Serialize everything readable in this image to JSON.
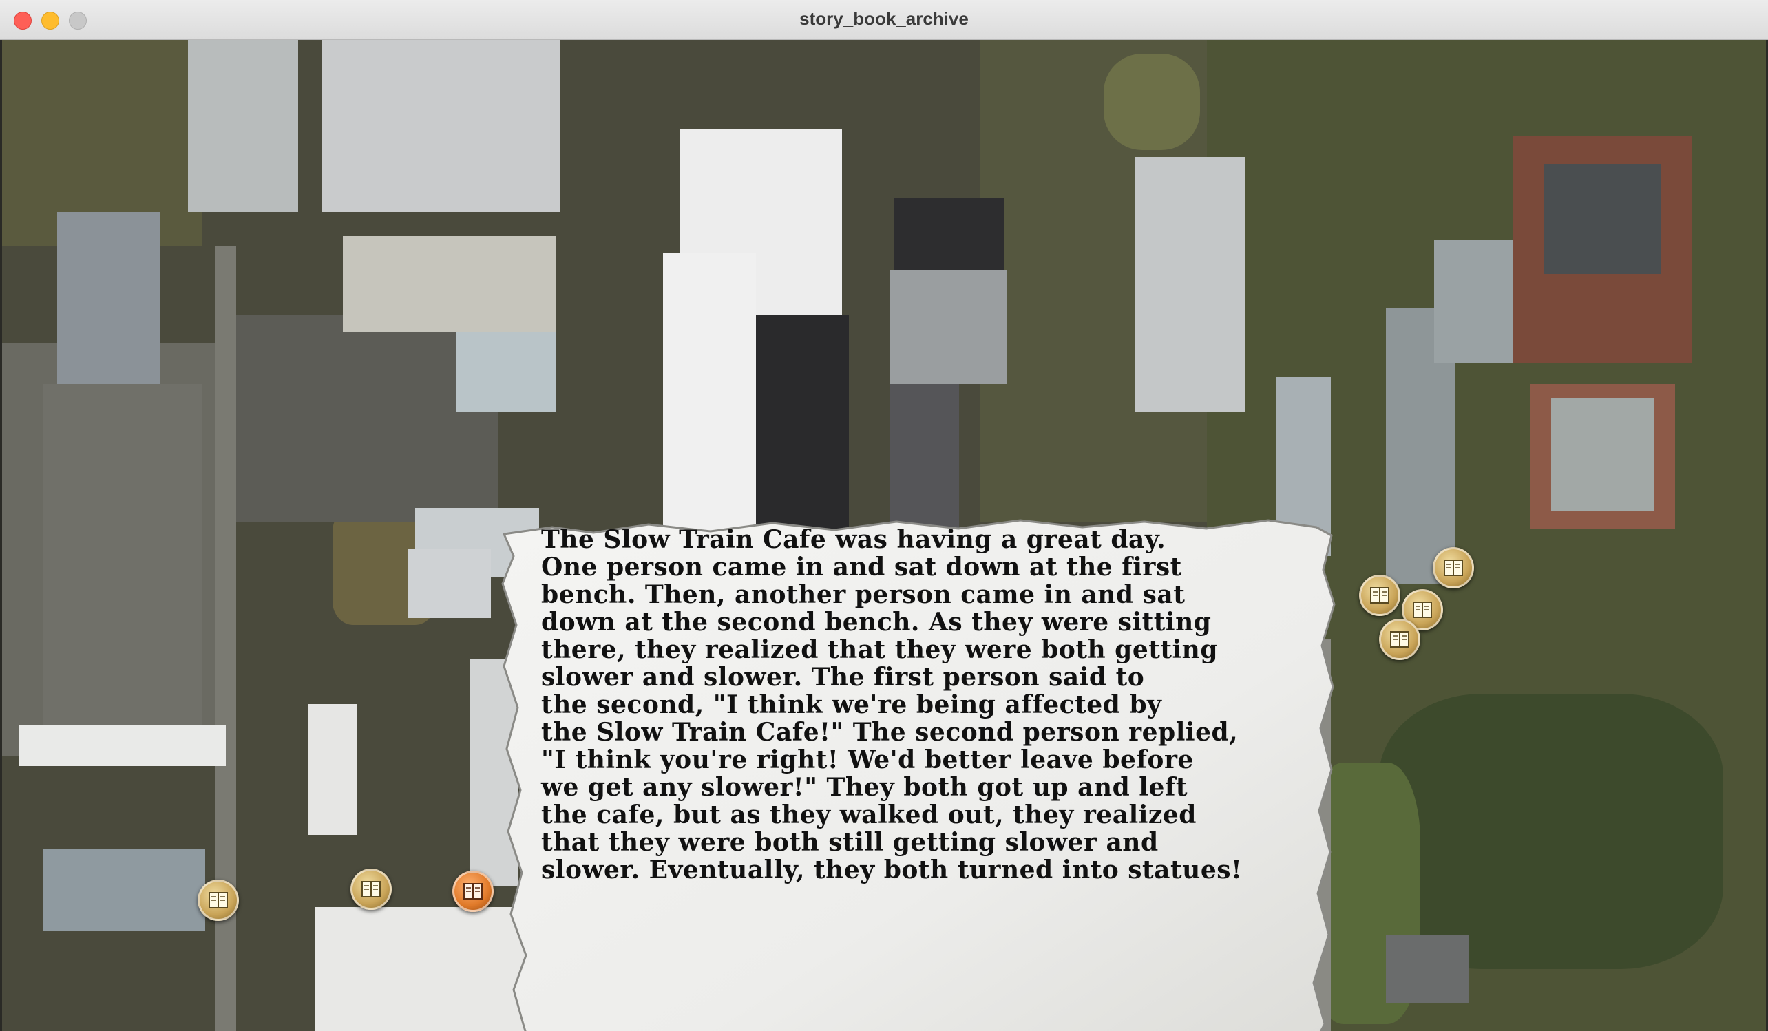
{
  "window": {
    "title": "story_book_archive"
  },
  "map": {
    "type": "satellite-aerial"
  },
  "story": {
    "text": "The Slow Train Cafe was having a great day.\nOne person came in and sat down at the first\nbench. Then, another person came in and sat\ndown at the second bench. As they were sitting\nthere, they realized that they were both getting\nslower and slower. The first person said to\nthe second, \"I think we're being affected by\nthe Slow Train Cafe!\" The second person replied,\n\"I think you're right! We'd better leave before\nwe get any slower!\" They both got up and left\nthe cafe, but as they walked out, they realized\nthat they were both still getting slower and\nslower. Eventually, they both turned into statues!"
  },
  "markers": [
    {
      "icon": "book-icon",
      "state": "normal"
    },
    {
      "icon": "book-icon",
      "state": "normal"
    },
    {
      "icon": "book-icon",
      "state": "active"
    },
    {
      "icon": "book-icon",
      "state": "normal"
    },
    {
      "icon": "book-icon",
      "state": "normal"
    },
    {
      "icon": "book-icon",
      "state": "normal"
    },
    {
      "icon": "book-icon",
      "state": "normal"
    }
  ],
  "colors": {
    "marker": "#c9a458",
    "marker_active": "#e07a2a",
    "parchment": "#efefed"
  }
}
